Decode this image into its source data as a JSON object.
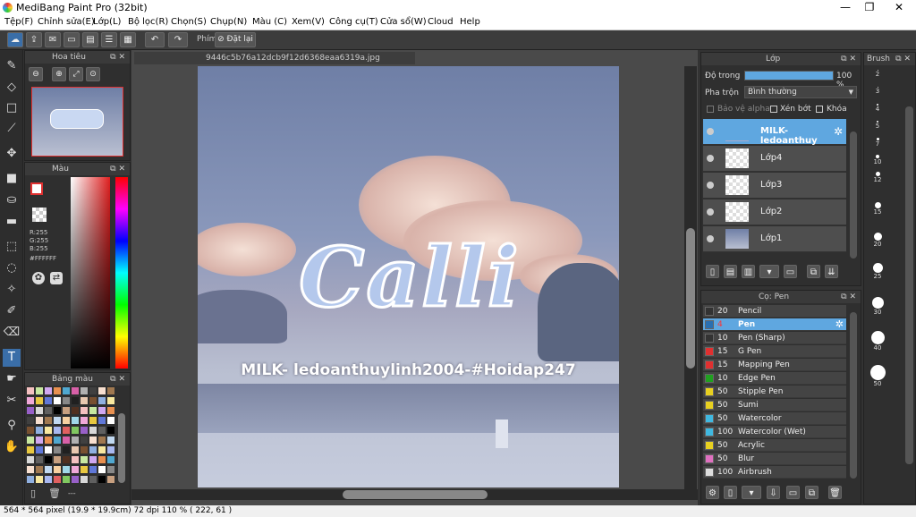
{
  "window": {
    "title": "MediBang Paint Pro (32bit)",
    "minimize": "—",
    "restore": "❐",
    "close": "✕"
  },
  "menu": [
    "Tệp(F)",
    "Chỉnh sửa(E)",
    "Lớp(L)",
    "Bộ lọc(R)",
    "Chọn(S)",
    "Chụp(N)",
    "Màu (C)",
    "Xem(V)",
    "Công cụ(T)",
    "Cửa sổ(W)",
    "Cloud",
    "Help"
  ],
  "toolbar": {
    "phim_label": "Phím",
    "reset_label": "Đặt lại"
  },
  "navigator": {
    "title": "Hoa tiêu"
  },
  "color_panel": {
    "title": "Màu",
    "r": "R:255",
    "g": "G:255",
    "b": "B:255",
    "hex": "#FFFFFF"
  },
  "palette_panel": {
    "title": "Bảng màu",
    "footer": "---"
  },
  "document": {
    "tab_title": "9446c5b76a12dcb9f12d6368eaa6319a.jpg",
    "art_title": "Calli",
    "art_caption": "MILK- ledoanthuylinh2004-#Hoidap247"
  },
  "layer_panel": {
    "title": "Lớp",
    "opacity_label": "Độ trong",
    "opacity_value": "100 %",
    "opacity": 1.0,
    "blend_label": "Pha trộn",
    "blend_value": "Bình thường",
    "protect_alpha": "Bảo vệ alpha",
    "clipping": "Xén bớt",
    "lock": "Khóa",
    "layers": [
      {
        "name": "MILK- ledoanthuy",
        "selected": true
      },
      {
        "name": "Lớp4",
        "selected": false
      },
      {
        "name": "Lớp3",
        "selected": false
      },
      {
        "name": "Lớp2",
        "selected": false
      },
      {
        "name": "Lớp1",
        "selected": false
      }
    ]
  },
  "brush_panel": {
    "title": "Cọ: Pen",
    "brushes": [
      {
        "width": "20",
        "name": "Pencil",
        "color": "#333333",
        "selected": false
      },
      {
        "width": "4",
        "name": "Pen",
        "color": "#2a6fb0",
        "selected": true
      },
      {
        "width": "10",
        "name": "Pen (Sharp)",
        "color": "#333333",
        "selected": false
      },
      {
        "width": "15",
        "name": "G Pen",
        "color": "#e03030",
        "selected": false
      },
      {
        "width": "15",
        "name": "Mapping Pen",
        "color": "#e03030",
        "selected": false
      },
      {
        "width": "10",
        "name": "Edge Pen",
        "color": "#20a020",
        "selected": false
      },
      {
        "width": "50",
        "name": "Stipple Pen",
        "color": "#e8d020",
        "selected": false
      },
      {
        "width": "50",
        "name": "Sumi",
        "color": "#e8d020",
        "selected": false
      },
      {
        "width": "50",
        "name": "Watercolor",
        "color": "#40b8e0",
        "selected": false
      },
      {
        "width": "100",
        "name": "Watercolor (Wet)",
        "color": "#40b8e0",
        "selected": false
      },
      {
        "width": "50",
        "name": "Acrylic",
        "color": "#e8d020",
        "selected": false
      },
      {
        "width": "50",
        "name": "Blur",
        "color": "#e070c0",
        "selected": false
      },
      {
        "width": "100",
        "name": "Airbrush",
        "color": "#dddddd",
        "selected": false
      }
    ]
  },
  "brush_size_panel": {
    "title": "Brush",
    "sizes": [
      "2",
      "3",
      "4",
      "5",
      "7",
      "10",
      "12",
      "15",
      "20",
      "25",
      "30",
      "40",
      "50"
    ]
  },
  "status": {
    "text": "564 * 564 pixel   (19.9 * 19.9cm)   72 dpi   110 %   ( 222, 61 )"
  }
}
